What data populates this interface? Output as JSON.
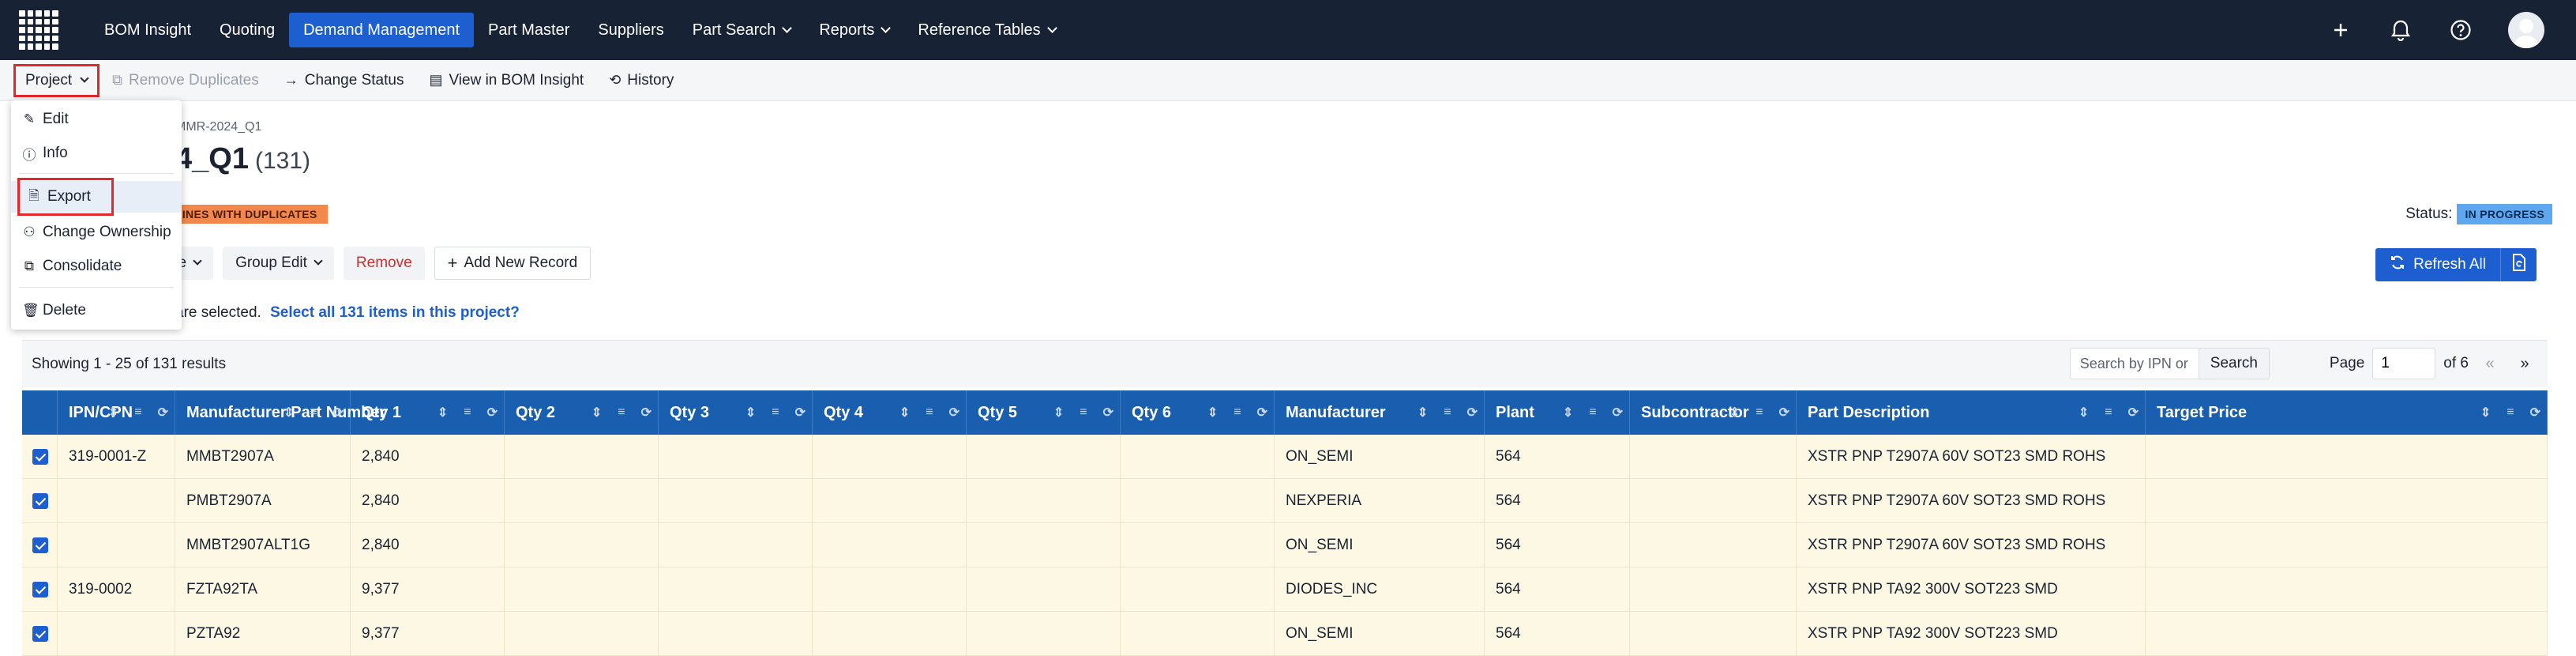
{
  "nav": {
    "items": [
      "BOM Insight",
      "Quoting",
      "Demand Management",
      "Part Master",
      "Suppliers",
      "Part Search",
      "Reports",
      "Reference Tables"
    ],
    "active": "Demand Management"
  },
  "toolbar": {
    "project": "Project",
    "remove_duplicates": "Remove Duplicates",
    "change_status": "Change Status",
    "view_in_bom": "View in BOM Insight",
    "history": "History"
  },
  "menu": {
    "edit": "Edit",
    "info": "Info",
    "export": "Export",
    "change_ownership": "Change Ownership",
    "consolidate": "Consolidate",
    "delete": "Delete"
  },
  "page": {
    "breadcrumb": "MMR-2024_Q1",
    "title": "4_Q1",
    "count": "(131)",
    "dup_badge": "LINES WITH DUPLICATES",
    "status_label": "Status:",
    "status_value": "IN PROGRESS"
  },
  "actions": {
    "move": "ve",
    "group_edit": "Group Edit",
    "remove": "Remove",
    "add_new": "Add New Record",
    "refresh_all": "Refresh All"
  },
  "selection": {
    "text": "are selected.",
    "link": "Select all 131 items in this project?"
  },
  "results": {
    "summary": "Showing 1 - 25 of 131 results",
    "search_placeholder": "Search by IPN or MPN",
    "search_button": "Search",
    "page_label": "Page",
    "page_value": "1",
    "page_of": "of 6",
    "first": "«",
    "next": "»"
  },
  "table": {
    "headers": [
      "IPN/CPN",
      "Manufacturer Part Number",
      "Qty 1",
      "Qty 2",
      "Qty 3",
      "Qty 4",
      "Qty 5",
      "Qty 6",
      "Manufacturer",
      "Plant",
      "Subcontractor",
      "Part Description",
      "Target Price"
    ],
    "rows": [
      [
        "319-0001-Z",
        "MMBT2907A",
        "2,840",
        "",
        "",
        "",
        "",
        "",
        "ON_SEMI",
        "564",
        "",
        "XSTR PNP T2907A 60V SOT23 SMD ROHS",
        ""
      ],
      [
        "",
        "PMBT2907A",
        "2,840",
        "",
        "",
        "",
        "",
        "",
        "NEXPERIA",
        "564",
        "",
        "XSTR PNP T2907A 60V SOT23 SMD ROHS",
        ""
      ],
      [
        "",
        "MMBT2907ALT1G",
        "2,840",
        "",
        "",
        "",
        "",
        "",
        "ON_SEMI",
        "564",
        "",
        "XSTR PNP T2907A 60V SOT23 SMD ROHS",
        ""
      ],
      [
        "319-0002",
        "FZTA92TA",
        "9,377",
        "",
        "",
        "",
        "",
        "",
        "DIODES_INC",
        "564",
        "",
        "XSTR PNP TA92 300V SOT223 SMD",
        ""
      ],
      [
        "",
        "PZTA92",
        "9,377",
        "",
        "",
        "",
        "",
        "",
        "ON_SEMI",
        "564",
        "",
        "XSTR PNP TA92 300V SOT223 SMD",
        ""
      ]
    ]
  },
  "colors": {
    "nav_bg": "#182235",
    "active_nav": "#1d5fd1",
    "table_header": "#1a5eb0",
    "row_bg": "#fcf8e4",
    "highlight_red": "#e3272b",
    "dup_badge": "#f2884c",
    "status_badge": "#5fa8f0"
  }
}
